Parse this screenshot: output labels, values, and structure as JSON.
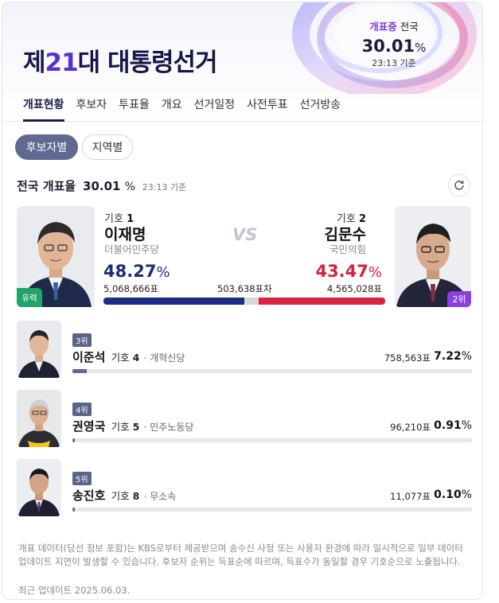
{
  "header": {
    "title_prefix": "제",
    "title_number": "21",
    "title_suffix": "대 대통령선거",
    "count_live": "개표중",
    "count_area": "전국",
    "count_pct": "30.01",
    "count_pct_unit": "%",
    "count_time": "23:13 기준"
  },
  "tabs": [
    "개표현황",
    "후보자",
    "투표율",
    "개요",
    "선거일정",
    "사전투표",
    "선거방송"
  ],
  "filters": {
    "candidate": "후보자별",
    "region": "지역별"
  },
  "summary": {
    "label": "전국 개표율",
    "pct": "30.01",
    "unit": "%",
    "time": "23:13 기준"
  },
  "top": {
    "vs": "VS",
    "gap": "503,638표차",
    "left": {
      "number_label": "기호",
      "number": "1",
      "name": "이재명",
      "party": "더불어민주당",
      "pct": "48.27",
      "unit": "%",
      "votes": "5,068,666표",
      "badge": "유력",
      "color": "#1c2e84"
    },
    "right": {
      "number_label": "기호",
      "number": "2",
      "name": "김문수",
      "party": "국민의힘",
      "pct": "43.47",
      "unit": "%",
      "votes": "4,565,028표",
      "badge": "2위",
      "color": "#d9233f"
    }
  },
  "others": [
    {
      "rank": "3위",
      "name": "이준석",
      "number_label": "기호",
      "number": "4",
      "party": "· 개혁신당",
      "votes": "758,563표",
      "pct": "7.22",
      "unit": "%",
      "share": 0.0722
    },
    {
      "rank": "4위",
      "name": "권영국",
      "number_label": "기호",
      "number": "5",
      "party": "· 민주노동당",
      "votes": "96,210표",
      "pct": "0.91",
      "unit": "%",
      "share": 0.0091
    },
    {
      "rank": "5위",
      "name": "송진호",
      "number_label": "기호",
      "number": "8",
      "party": "· 무소속",
      "votes": "11,077표",
      "pct": "0.10",
      "unit": "%",
      "share": 0.001
    }
  ],
  "footer": {
    "notice": "개표 데이터(당선 정보 포함)는 KBS로부터 제공받으며 송수신 사정 또는 사용자 환경에 따라 일시적으로 일부 데이터 업데이트 지연이 발생할 수 있습니다. 후보자 순위는 득표순에 따르며, 득표수가 동일할 경우 기호순으로 노출됩니다.",
    "updated": "최근 업데이트 2025.06.03."
  }
}
